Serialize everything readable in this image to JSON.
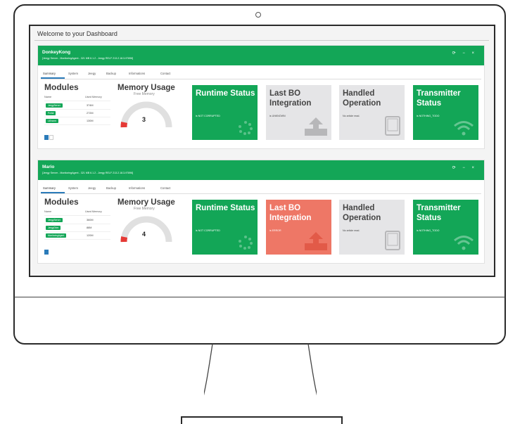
{
  "dashboard": {
    "welcome": "Welcome to your Dashboard",
    "tabs": [
      "Summary",
      "System",
      "Jeegy",
      "Backup",
      "Informations",
      "Contact"
    ],
    "colors": {
      "green": "#13a657",
      "grey": "#e5e5e7",
      "red": "#ee7766",
      "blue": "#2b7bb9"
    }
  },
  "panels": [
    {
      "name": "DonkeyKong",
      "subtitle": "[Jeegy Server - MonitoringAgent - 321 MB 6.1.2 - Jeegy RELF 213.2.18.3-97896]",
      "header_icons": "⟳ − ×",
      "modules_title": "Modules",
      "col_name": "Name",
      "col_memory": "Used Memory",
      "modules": [
        {
          "name": "JeegyServer",
          "memory": "374M"
        },
        {
          "name": "Portal",
          "memory": "272M"
        },
        {
          "name": "LiEnorm",
          "memory": "130M"
        }
      ],
      "pages": [
        "1",
        "2"
      ],
      "memory_title": "Memory Usage",
      "memory_sub": "Free Memory",
      "gauge_value": "3",
      "tiles": [
        {
          "title": "Runtime Status",
          "status": "is NOT CORRUPTED",
          "color": "green",
          "icon": "spinner-icon"
        },
        {
          "title": "Last BO Integration",
          "status": "is UNKNOWN",
          "color": "grey",
          "icon": "upload-icon"
        },
        {
          "title": "Handled Operation",
          "status": "No article read.",
          "color": "grey",
          "icon": "tablet-icon"
        },
        {
          "title": "Transmitter Status",
          "status": "is NOTHING_TODO",
          "color": "green",
          "icon": "wifi-icon"
        }
      ]
    },
    {
      "name": "Mario",
      "subtitle": "[Jeegy Server - MonitoringAgent - 321 MB 6.1.2 - Jeegy RELF 213.2.18.3-97896]",
      "header_icons": "⟳ − ×",
      "modules_title": "Modules",
      "col_name": "Name",
      "col_memory": "Used Memory",
      "modules": [
        {
          "name": "JeegyServer",
          "memory": "360M"
        },
        {
          "name": "JeegyDbm",
          "memory": "88M"
        },
        {
          "name": "MonitoringAgent",
          "memory": "120M"
        }
      ],
      "pages": [
        "1"
      ],
      "memory_title": "Memory Usage",
      "memory_sub": "Free Memory",
      "gauge_value": "4",
      "tiles": [
        {
          "title": "Runtime Status",
          "status": "is NOT CORRUPTED",
          "color": "green",
          "icon": "spinner-icon"
        },
        {
          "title": "Last BO Integration",
          "status": "is ERROR",
          "color": "red",
          "icon": "upload-icon"
        },
        {
          "title": "Handled Operation",
          "status": "No article read.",
          "color": "grey",
          "icon": "tablet-icon"
        },
        {
          "title": "Transmitter Status",
          "status": "is NOTHING_TODO",
          "color": "green",
          "icon": "wifi-icon"
        }
      ]
    }
  ]
}
